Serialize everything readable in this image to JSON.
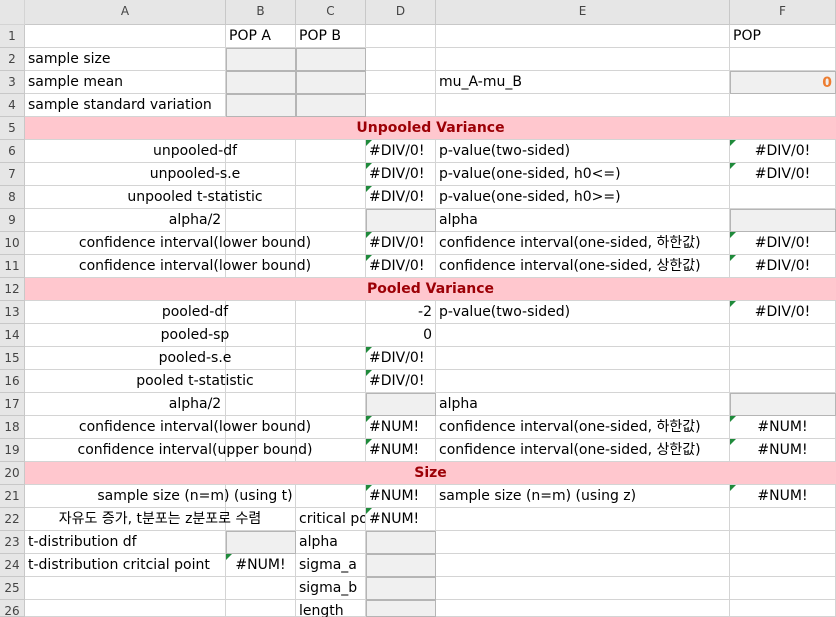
{
  "columns": [
    "A",
    "B",
    "C",
    "D",
    "E",
    "F"
  ],
  "rows": [
    "1",
    "2",
    "3",
    "4",
    "5",
    "6",
    "7",
    "8",
    "9",
    "10",
    "11",
    "12",
    "13",
    "14",
    "15",
    "16",
    "17",
    "18",
    "19",
    "20",
    "21",
    "22",
    "23",
    "24",
    "25",
    "26"
  ],
  "header_row": {
    "pop_a": "POP A",
    "pop_b": "POP B",
    "pop": "POP"
  },
  "inputs_section": {
    "sample_size": "sample size",
    "sample_mean": "sample mean",
    "sample_std": "sample standard variation",
    "mu_diff_label": "mu_A-mu_B",
    "mu_diff_value": "0"
  },
  "unpooled": {
    "title": "Unpooled Variance",
    "df_label": "unpooled-df",
    "df_value": "#DIV/0!",
    "se_label": "unpooled-s.e",
    "se_value": "#DIV/0!",
    "t_label": "unpooled t-statistic",
    "t_value": "#DIV/0!",
    "alpha_half_label": "alpha/2",
    "ci_lower_label": "confidence interval(lower bound)",
    "ci_lower_value": "#DIV/0!",
    "ci_lower2_label": "confidence interval(lower bound)",
    "ci_lower2_value": "#DIV/0!",
    "p_two_label": "p-value(two-sided)",
    "p_two_value": "#DIV/0!",
    "p_one_le_label": "p-value(one-sided, h0<=)",
    "p_one_le_value": "#DIV/0!",
    "p_one_ge_label": "p-value(one-sided, h0>=)",
    "alpha_label": "alpha",
    "ci_one_low_label": "confidence interval(one-sided, 하한값)",
    "ci_one_low_value": "#DIV/0!",
    "ci_one_up_label": "confidence interval(one-sided, 상한값)",
    "ci_one_up_value": "#DIV/0!"
  },
  "pooled": {
    "title": "Pooled Variance",
    "df_label": "pooled-df",
    "df_value": "-2",
    "sp_label": "pooled-sp",
    "sp_value": "0",
    "se_label": "pooled-s.e",
    "se_value": "#DIV/0!",
    "t_label": "pooled t-statistic",
    "t_value": "#DIV/0!",
    "alpha_half_label": "alpha/2",
    "ci_lower_label": "confidence interval(lower bound)",
    "ci_lower_value": "#NUM!",
    "ci_upper_label": "confidence interval(upper bound)",
    "ci_upper_value": "#NUM!",
    "p_two_label": "p-value(two-sided)",
    "p_two_value": "#DIV/0!",
    "alpha_label": "alpha",
    "ci_one_low_label": "confidence interval(one-sided, 하한값)",
    "ci_one_low_value": "#NUM!",
    "ci_one_up_label": "confidence interval(one-sided, 상한값)",
    "ci_one_up_value": "#NUM!"
  },
  "size": {
    "title": "Size",
    "n_t_label": "sample size (n=m) (using t)",
    "n_t_value": "#NUM!",
    "n_z_label": "sample size (n=m) (using z)",
    "n_z_value": "#NUM!",
    "note": "자유도 증가, t분포는 z분포로 수렴",
    "critical_label": "critical po",
    "critical_value": "#NUM!",
    "t_df_label": "t-distribution df",
    "t_crit_label": "t-distribution critcial point",
    "t_crit_value": "#NUM!",
    "alpha_label": "alpha",
    "sigma_a_label": "sigma_a",
    "sigma_b_label": "sigma_b",
    "length_label": "length"
  }
}
